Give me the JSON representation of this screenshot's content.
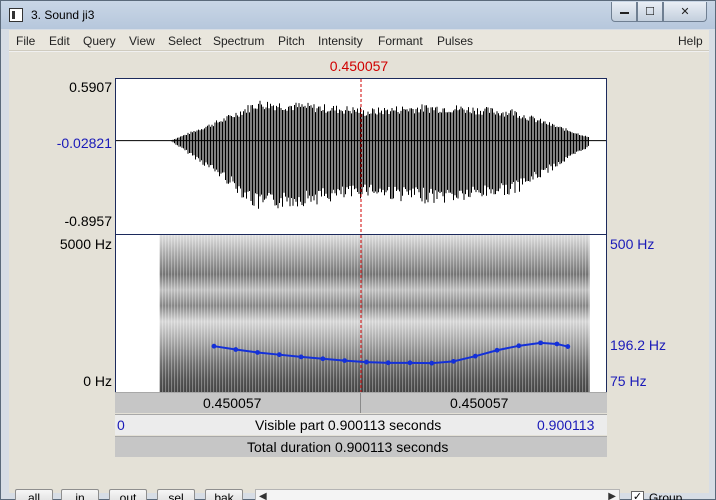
{
  "window": {
    "title": "3. Sound ji3",
    "min_glyph": "",
    "max_glyph": "☐",
    "close_glyph": "✕"
  },
  "menu": [
    {
      "label": "File",
      "name": "menu-file"
    },
    {
      "label": "Edit",
      "name": "menu-edit"
    },
    {
      "label": "Query",
      "name": "menu-query"
    },
    {
      "label": "View",
      "name": "menu-view"
    },
    {
      "label": "Select",
      "name": "menu-select"
    },
    {
      "label": "Spectrum",
      "name": "menu-spectrum"
    },
    {
      "label": "Pitch",
      "name": "menu-pitch"
    },
    {
      "label": "Intensity",
      "name": "menu-intensity"
    },
    {
      "label": "Formant",
      "name": "menu-formant"
    },
    {
      "label": "Pulses",
      "name": "menu-pulses"
    },
    {
      "label": "Help",
      "name": "menu-help"
    }
  ],
  "cursor": {
    "time_label": "0.450057",
    "time_value": 0.450057
  },
  "waveform": {
    "ymax_label": "0.5907",
    "ycursor_label": "-0.02821",
    "ymin_label": "-0.8957",
    "ymax": 0.5907,
    "ymin": -0.8957,
    "ycursor": -0.02821
  },
  "spectrogram": {
    "top_label": "5000 Hz",
    "bottom_label": "0 Hz",
    "pitch_top_label": "500 Hz",
    "pitch_mid_label": "196.2 Hz",
    "pitch_bottom_label": "75 Hz",
    "pitch_min_hz": 75,
    "pitch_max_hz": 500,
    "pitch_track": {
      "time": [
        0.18,
        0.22,
        0.26,
        0.3,
        0.34,
        0.38,
        0.42,
        0.46,
        0.5,
        0.54,
        0.58,
        0.62,
        0.66,
        0.7,
        0.74,
        0.78,
        0.81,
        0.83
      ],
      "hz": [
        199,
        190,
        182,
        176,
        170,
        165,
        160,
        156,
        154,
        154,
        153,
        158,
        172,
        188,
        200,
        208,
        205,
        198
      ]
    }
  },
  "bars": {
    "left_time": "0.450057",
    "right_time": "0.450057",
    "visible_start": "0",
    "visible_text": "Visible part 0.900113 seconds",
    "visible_end": "0.900113",
    "total_text": "Total duration 0.900113 seconds"
  },
  "controls": {
    "all": "all",
    "in": "in",
    "out": "out",
    "sel": "sel",
    "bak": "bak",
    "scroll_left": "◀",
    "scroll_right": "▶",
    "group_label": "Group",
    "group_checked": true,
    "check_glyph": "✓"
  },
  "sound": {
    "duration": 0.900113
  },
  "colors": {
    "cursor": "#d00000",
    "pitch_track": "#1430d8",
    "axis_blue": "#1a1ab8"
  }
}
